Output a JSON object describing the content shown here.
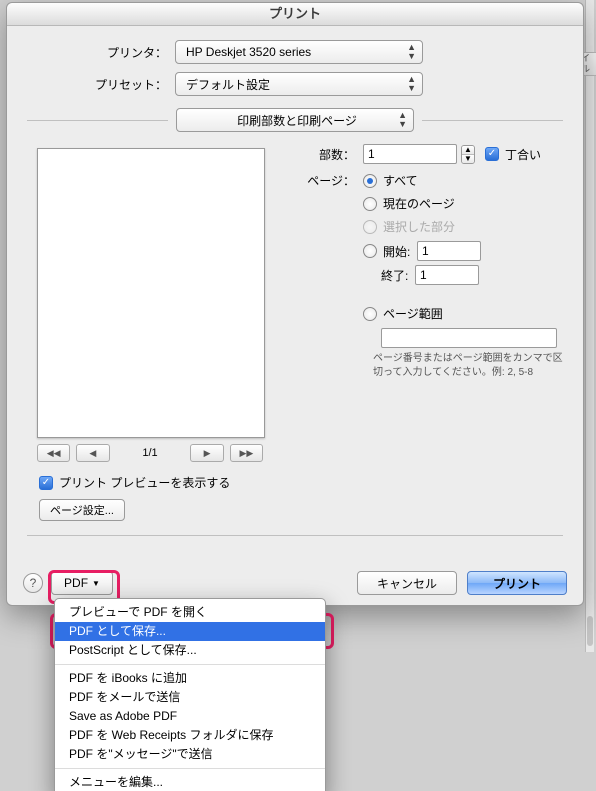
{
  "title": "プリント",
  "printer": {
    "label": "プリンタ：",
    "value": "HP Deskjet 3520 series"
  },
  "preset": {
    "label": "プリセット：",
    "value": "デフォルト設定"
  },
  "panel": {
    "value": "印刷部数と印刷ページ"
  },
  "copies": {
    "label": "部数：",
    "value": "1",
    "collate_label": "丁合い"
  },
  "pages": {
    "label": "ページ：",
    "all": "すべて",
    "current": "現在のページ",
    "selection": "選択した部分",
    "from_label": "開始:",
    "to_label": "終了:",
    "from_value": "1",
    "to_value": "1",
    "range_label": "ページ範囲",
    "range_value": "",
    "range_hint": "ページ番号またはページ範囲をカンマで区切って入力してください。例: 2, 5-8"
  },
  "pager": {
    "text": "1/1"
  },
  "show_preview": {
    "label": "プリント プレビューを表示する"
  },
  "page_setup": {
    "label": "ページ設定..."
  },
  "pdf_button": {
    "label": "PDF"
  },
  "cancel": "キャンセル",
  "print": "プリント",
  "behind_tab": "イル",
  "menu": {
    "open": "プレビューで PDF を開く",
    "save_as_pdf": "PDF として保存...",
    "save_as_ps": "PostScript として保存...",
    "add_ibooks": "PDF を iBooks に追加",
    "mail": "PDF をメールで送信",
    "adobe": "Save as Adobe PDF",
    "web_receipts": "PDF を Web Receipts フォルダに保存",
    "messages": "PDF を\"メッセージ\"で送信",
    "edit": "メニューを編集..."
  }
}
